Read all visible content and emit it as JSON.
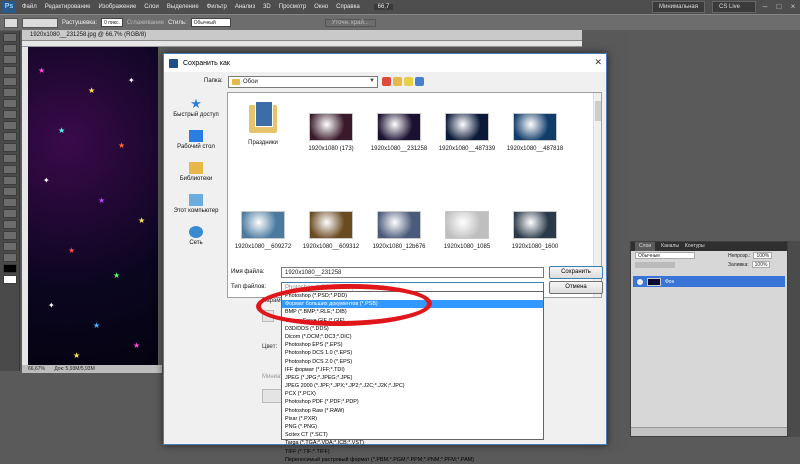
{
  "ps": {
    "logo": "Ps",
    "menu": [
      "Файл",
      "Редактирование",
      "Изображение",
      "Слои",
      "Выделение",
      "Фильтр",
      "Анализ",
      "3D",
      "Просмотр",
      "Окно",
      "Справка"
    ],
    "zoom_box": "66,7",
    "workspace_label": "Минимальная",
    "cs_live": "CS Live",
    "options": {
      "feather_label": "Растушевка:",
      "feather_value": "0 пикс.",
      "smooth_label": "Сглаживание",
      "style_label": "Стиль:",
      "style_value": "Обычный",
      "refine_label": "Уточн. край..."
    },
    "doc_tab": "1920x1080__231258.jpg @ 66,7% (RGB/8)",
    "status": "66,67%",
    "status_doc": "Док: 5,93M/5,93M"
  },
  "layers": {
    "tabs": [
      "Слои",
      "Каналы",
      "Контуры"
    ],
    "blend": "Обычные",
    "opacity_label": "Непрозр.:",
    "opacity": "100%",
    "fill_label": "Заливка:",
    "fill": "100%",
    "layer_name": "Фон"
  },
  "dialog": {
    "title": "Сохранить как",
    "folder_label": "Папка:",
    "folder_value": "Обои",
    "places": [
      "Быстрый доступ",
      "Рабочий стол",
      "Библиотеки",
      "Этот компьютер",
      "Сеть"
    ],
    "files": [
      {
        "name": "Праздники",
        "kind": "folder"
      },
      {
        "name": "1920x1080 (173)",
        "kind": "image",
        "color": "#3a1a2a"
      },
      {
        "name": "1920x1080__231258",
        "kind": "image",
        "color": "#1a1030"
      },
      {
        "name": "1920x1080__487339",
        "kind": "image",
        "color": "#0c1a3a"
      },
      {
        "name": "1920x1080__487818",
        "kind": "image",
        "color": "#103c6a"
      },
      {
        "name": "1920x1080__609272",
        "kind": "image",
        "color": "#4a7aa0"
      },
      {
        "name": "1920x1080__609312",
        "kind": "image",
        "color": "#6a4a20"
      },
      {
        "name": "1920x1080_12b676",
        "kind": "image",
        "color": "#4a5a7a"
      },
      {
        "name": "1920x1080_1085",
        "kind": "image",
        "color": "#bfbfbf"
      },
      {
        "name": "1920x1080_1600",
        "kind": "image",
        "color": "#2a3a4a"
      }
    ],
    "filename_label": "Имя файла:",
    "filename_value": "1920x1080__231258",
    "filetype_label": "Тип файлов:",
    "filetype_value": "Photoshop (*.PSD;*.PDD)",
    "save_button": "Сохранить",
    "cancel_button": "Отмена",
    "behind_labels": {
      "options": "Параметры",
      "color": "Цвет:",
      "thumb": "Миниатюра"
    }
  },
  "dropdown": {
    "items": [
      "Photoshop (*.PSD;*.PDD)",
      "Формат больших документов (*.PSB)",
      "BMP (*.BMP;*.RLE;*.DIB)",
      "CompuServe GIF (*.GIF)",
      "D3D/DDS (*.DDS)",
      "Dicom (*.DCM;*.DC3;*.DIC)",
      "Photoshop EPS (*.EPS)",
      "Photoshop DCS 1.0 (*.EPS)",
      "Photoshop DCS 2.0 (*.EPS)",
      "IFF формат (*.IFF;*.TDI)",
      "JPEG (*.JPG;*.JPEG;*.JPE)",
      "JPEG 2000 (*.JPF;*.JPX;*.JP2;*.J2C;*.J2K;*.JPC)",
      "PCX (*.PCX)",
      "Photoshop PDF (*.PDF;*.PDP)",
      "Photoshop Raw (*.RAW)",
      "Pixar (*.PXR)",
      "PNG (*.PNG)",
      "Scitex CT (*.SCT)",
      "Targa (*.TGA;*.VDA;*.ICB;*.VST)",
      "TIFF (*.TIF;*.TIFF)",
      "Переносимый растровый формат (*.PBM;*.PGM;*.PPM;*.PNM;*.PFM;*.PAM)"
    ],
    "selected_index": 1
  }
}
